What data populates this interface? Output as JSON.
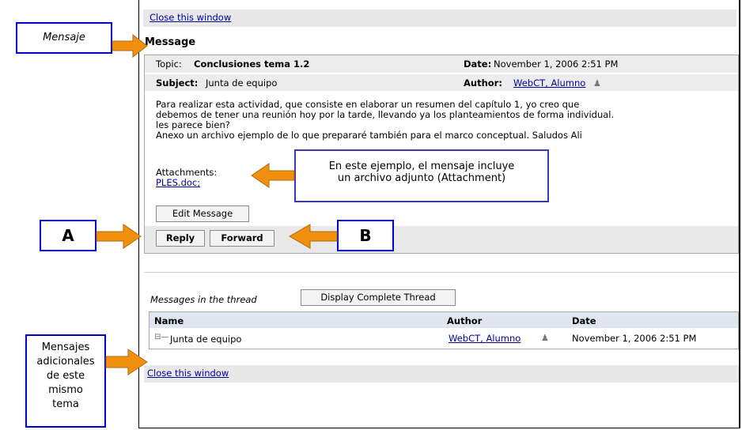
{
  "window": {
    "close_top": "Close this window",
    "close_bottom": "Close this window"
  },
  "message": {
    "heading": "Message",
    "topic_label": "Topic:",
    "topic_value": "Conclusiones tema 1.2",
    "date_label": "Date:",
    "date_value": "November 1, 2006 2:51 PM",
    "subject_label": "Subject:",
    "subject_value": "Junta de equipo",
    "author_label": "Author:",
    "author_value": "WebCT, Alumno",
    "body_lines": [
      "Para realizar esta actividad, que consiste en elaborar un resumen del capítulo 1, yo creo que",
      "debemos de tener una reunión hoy por la tarde, llevando ya los planteamientos de forma individual.",
      "les parece bien?",
      "Anexo un archivo ejemplo de lo que prepararé también para el marco conceptual. Saludos Ali"
    ],
    "attachments_label": "Attachments:",
    "attachment_file": "PLES.doc;",
    "edit_button": "Edit Message",
    "reply_button": "Reply",
    "forward_button": "Forward"
  },
  "thread": {
    "label": "Messages in the thread",
    "display_button": "Display Complete Thread",
    "columns": [
      "Name",
      "Author",
      "Date"
    ],
    "rows": [
      {
        "name": "Junta de equipo",
        "author": "WebCT, Alumno",
        "date": "November 1, 2006 2:51 PM"
      }
    ]
  },
  "annotations": {
    "mensaje": "Mensaje",
    "attachment_note_line1": "En este ejemplo, el mensaje incluye",
    "attachment_note_line2": "un archivo adjunto (Attachment)",
    "a": "A",
    "b": "B",
    "adicionales": [
      "Mensajes",
      "adicionales",
      "de este",
      "mismo",
      "tema"
    ]
  },
  "colors": {
    "callout_border": "#0000cc",
    "arrow_fill": "#f0900e",
    "link": "#00009c"
  }
}
